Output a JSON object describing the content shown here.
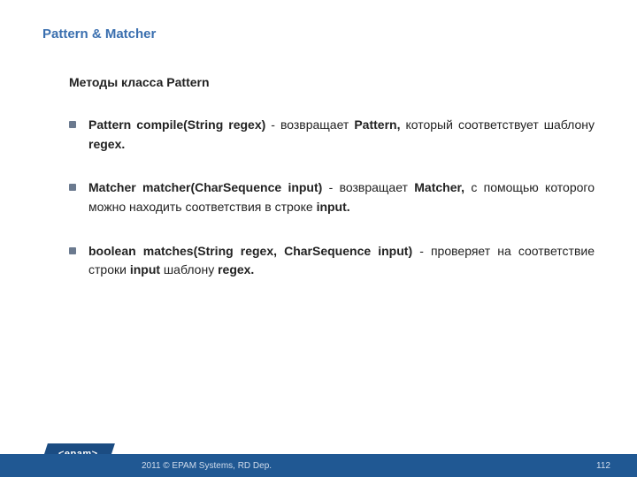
{
  "title": "Pattern & Matcher",
  "subtitle": "Методы класса Pattern",
  "bullets": [
    {
      "sig": "Pattern compile(String regex)",
      "sep": " - ",
      "t1": "возвращает ",
      "obj": "Pattern,",
      "t2": " который соответствует шаблону ",
      "tail": "regex."
    },
    {
      "sig": "Matcher matcher(CharSequence input)",
      "sep": " - ",
      "t1": "возвращает ",
      "obj": "Matcher,",
      "t2": " с помощью которого можно находить соответствия в строке ",
      "tail": "input."
    },
    {
      "sig": "boolean matches(String regex, CharSequence input)",
      "sep": " - ",
      "t1": "проверяет на соответствие строки ",
      "obj": "input",
      "t2": " шаблону ",
      "tail": "regex."
    }
  ],
  "footer": {
    "logo": "<epam>",
    "copyright": "2011 © EPAM Systems, RD Dep.",
    "page": "112"
  }
}
